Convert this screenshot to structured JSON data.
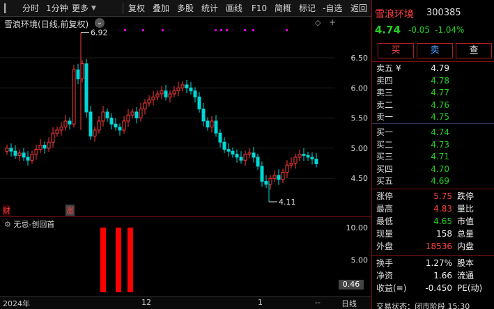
{
  "toolbar": {
    "items": [
      "分时",
      "1分钟",
      "更多",
      "复权",
      "叠加",
      "多股",
      "统计",
      "画线",
      "F10",
      "简概",
      "标记",
      "-自选",
      "返回"
    ]
  },
  "main_chart": {
    "title": "雪浪环境",
    "mode": "(日线,前复权)",
    "y_ticks": [
      "6.50",
      "6.00",
      "5.50",
      "5.00",
      "4.50"
    ],
    "high_annotation": "6.92",
    "low_annotation": "4.11",
    "tag_cai": "财",
    "tag_zhang": "涨",
    "colors": {
      "up": "#ff3b3b",
      "down": "#00d8d8",
      "marker": "#e000e0"
    }
  },
  "indicator": {
    "name": "无忌-创回首",
    "y_ticks": [
      "10.00",
      "5.00"
    ],
    "current_value": "0.46",
    "bar_color": "#ff0000"
  },
  "axis": {
    "labels": [
      "2024年",
      "12",
      "1"
    ],
    "right_label": "日线"
  },
  "quote": {
    "name": "雪浪环境",
    "code": "300385",
    "price": "4.74",
    "change": "-0.05",
    "change_pct": "-1.04%",
    "buttons": [
      "买",
      "卖",
      "查"
    ],
    "asks": [
      {
        "label": "卖五",
        "flag": "¥",
        "price": "4.79",
        "color": "white"
      },
      {
        "label": "卖四",
        "price": "4.78",
        "color": "green"
      },
      {
        "label": "卖三",
        "price": "4.77",
        "color": "green"
      },
      {
        "label": "卖二",
        "price": "4.76",
        "color": "green"
      },
      {
        "label": "卖一",
        "price": "4.75",
        "color": "green"
      }
    ],
    "bids": [
      {
        "label": "买一",
        "price": "4.74",
        "color": "green"
      },
      {
        "label": "买二",
        "price": "4.73",
        "color": "green"
      },
      {
        "label": "买三",
        "price": "4.71",
        "color": "green"
      },
      {
        "label": "买四",
        "price": "4.70",
        "color": "green"
      },
      {
        "label": "买五",
        "price": "4.69",
        "color": "green"
      }
    ],
    "stats": [
      {
        "l1": "涨停",
        "v1": "5.75",
        "c1": "red",
        "l2": "跌停"
      },
      {
        "l1": "最高",
        "v1": "4.83",
        "c1": "red",
        "l2": "量比"
      },
      {
        "l1": "最低",
        "v1": "4.65",
        "c1": "green",
        "l2": "市值"
      },
      {
        "l1": "现量",
        "v1": "158",
        "c1": "white",
        "l2": "总量"
      },
      {
        "l1": "外盘",
        "v1": "18536",
        "c1": "red",
        "l2": "内盘"
      }
    ],
    "stats2": [
      {
        "l1": "换手",
        "v1": "1.27%",
        "c1": "white",
        "l2": "股本"
      },
      {
        "l1": "净资",
        "v1": "1.66",
        "c1": "white",
        "l2": "流通"
      },
      {
        "l1": "收益(≡)",
        "v1": "-0.450",
        "c1": "white",
        "l2": "PE(动)"
      }
    ],
    "bottom_note": "交易状态：闭市阶段 15:30"
  }
}
